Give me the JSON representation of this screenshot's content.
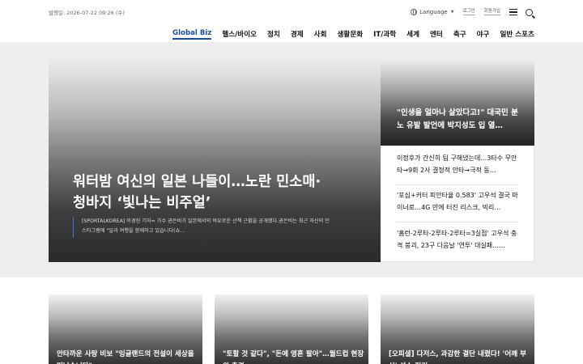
{
  "header": {
    "pubdate": "발행일: 2026-07-22 09:26 (수)",
    "language_label": "Language",
    "util_link_1": "로그인",
    "util_link_2": "회원가입"
  },
  "nav": {
    "items": [
      "Global Biz",
      "헬스/바이오",
      "정치",
      "경제",
      "사회",
      "생활문화",
      "IT/과학",
      "세계",
      "엔터",
      "축구",
      "야구",
      "일반 스포츠"
    ],
    "active_index": 0,
    "active_color": "#1d4f9c"
  },
  "hero": {
    "title": "워터밤 여신의 일본 나들이…노란 민소매·청바지 ‘빛나는 비주얼’",
    "summary": "[SPORTALKOREA] 이경헌 기자= 가수 권은비가 일본에서의 여유로운 산책 근황을 공개했다.권은비는 최근 자신의 인스타그램에 \"일과 여행을 함께하고 있습니다(쇼…",
    "accent_color": "#3f79d6"
  },
  "side": {
    "top_title": "\"인생을 얼마나 살았다고!\" 대국민 분노 유발 발언에 박지성도 입 열…",
    "items": [
      "이정후가 간신히 팀 구해냈는데…3타수 무안타→9회 2사 결정적 안타→극적 동…",
      "'포심+커터 피안타율 0.583' 고우석 결국 마이너로…4G 만에 터진 리스크, 빅리…",
      "'홈런-2루타-2루타-2루타=3실점' 고우석 충격 붕괴, 23구 다음날 '연투' 대실패……"
    ]
  },
  "cards": [
    "안타까운 사랑 비보 \"잉글랜드의 전설이 세상을 떠났습니다\"…",
    "\"토할 것 같다\", \"돈에 영혼 팔아\"…월드컵 현장의 충격",
    "[오피셜] 다저스, 과감한 결단 내렸다! '어깨 부상' 선수 정리"
  ]
}
